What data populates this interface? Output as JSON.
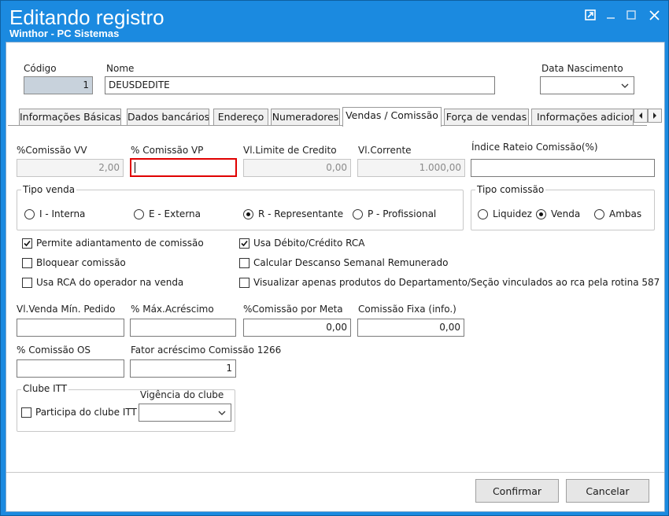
{
  "window": {
    "title": "Editando registro",
    "subtitle": "Winthor - PC Sistemas"
  },
  "header": {
    "codigo_label": "Código",
    "codigo_value": "1",
    "nome_label": "Nome",
    "nome_value": "DEUSDEDITE",
    "data_nasc_label": "Data Nascimento",
    "data_nasc_value": ""
  },
  "tabs": [
    {
      "label": "Informações Básicas",
      "active": false
    },
    {
      "label": "Dados bancários",
      "active": false
    },
    {
      "label": "Endereço",
      "active": false
    },
    {
      "label": "Numeradores",
      "active": false
    },
    {
      "label": "Vendas  / Comissão",
      "active": true
    },
    {
      "label": "Força de vendas",
      "active": false
    },
    {
      "label": "Informações adicionais",
      "active": false
    }
  ],
  "comissao": {
    "vv_label": "%Comissão VV",
    "vv_value": "2,00",
    "vp_label": "% Comissão VP",
    "vp_value": "",
    "limite_label": "Vl.Limite de Credito",
    "limite_value": "0,00",
    "corrente_label": "Vl.Corrente",
    "corrente_value": "1.000,00",
    "rateio_label": "Índice Rateio Comissão(%)",
    "rateio_value": ""
  },
  "tipo_venda": {
    "title": "Tipo venda",
    "options": [
      {
        "label": "I - Interna",
        "selected": false
      },
      {
        "label": "E - Externa",
        "selected": false
      },
      {
        "label": "R - Representante",
        "selected": true
      },
      {
        "label": "P - Profissional",
        "selected": false
      }
    ]
  },
  "tipo_comissao": {
    "title": "Tipo comissão",
    "options": [
      {
        "label": "Liquidez",
        "selected": false
      },
      {
        "label": "Venda",
        "selected": true
      },
      {
        "label": "Ambas",
        "selected": false
      }
    ]
  },
  "checks": [
    {
      "label": "Permite adiantamento de comissão",
      "checked": true
    },
    {
      "label": "Usa Débito/Crédito RCA",
      "checked": true
    },
    {
      "label": "Bloquear comissão",
      "checked": false
    },
    {
      "label": "Calcular Descanso Semanal Remunerado",
      "checked": false
    },
    {
      "label": "Usa RCA do operador na venda",
      "checked": false
    },
    {
      "label": "Visualizar apenas produtos do Departamento/Seção vinculados ao rca pela rotina 587",
      "checked": false
    }
  ],
  "valores": {
    "venda_min_label": "Vl.Venda Mín. Pedido",
    "venda_min_value": "",
    "max_acresc_label": "% Máx.Acréscimo",
    "max_acresc_value": "",
    "meta_label": "%Comissão por Meta",
    "meta_value": "0,00",
    "fixa_label": "Comissão Fixa (info.)",
    "fixa_value": "0,00",
    "os_label": "% Comissão OS",
    "os_value": "",
    "fator_label": "Fator acréscimo Comissão 1266",
    "fator_value": "1"
  },
  "clube": {
    "title": "Clube ITT",
    "participa_label": "Participa do clube ITT",
    "participa_checked": false,
    "vigencia_label": "Vigência do clube",
    "vigencia_value": ""
  },
  "buttons": {
    "confirmar_label": "Confirmar",
    "cancelar_label": "Cancelar"
  },
  "icons": {
    "restore": "restore-icon",
    "minimize": "minimize-icon",
    "maximize": "maximize-icon",
    "close": "close-icon",
    "chevron": "chevron-down-icon",
    "check": "checkmark-icon",
    "tab_prev": "chevron-left-icon",
    "tab_next": "chevron-right-icon"
  }
}
